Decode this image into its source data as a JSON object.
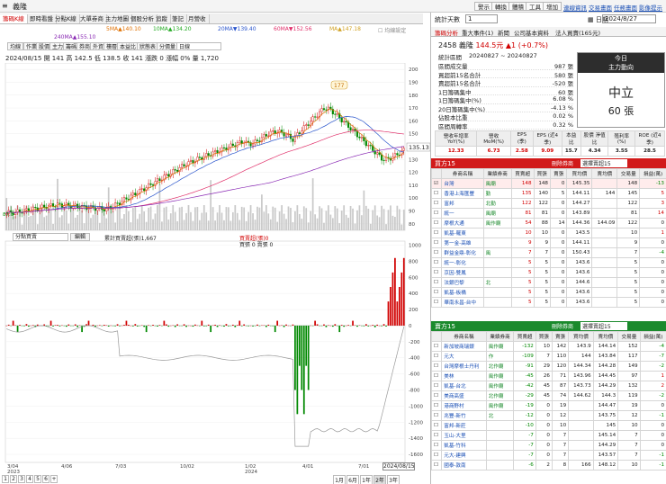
{
  "topbar": {
    "menu_icon": "≡",
    "title": "義隆",
    "buttons": [
      "警示",
      "轉換",
      "體積",
      "工具",
      "增加"
    ],
    "links": [
      "連線資訊",
      "交易畫面",
      "任務畫面",
      "影像提示"
    ]
  },
  "tabs": [
    "籌碼K線",
    "即時看盤",
    "分點K線",
    "大單券商",
    "主力地圖",
    "個股分析",
    "追蹤",
    "筆記",
    "月營收"
  ],
  "ma_legend": [
    {
      "label": "5MA▲140.10",
      "color": "#e07000"
    },
    {
      "label": "10MA▲134.20",
      "color": "#22aa22"
    },
    {
      "label": "20MA▼139.40",
      "color": "#2a55cc"
    },
    {
      "label": "60MA▼152.56",
      "color": "#e0306a"
    },
    {
      "label": "MA▲147.18",
      "color": "#d0a020"
    },
    {
      "label": "240MA▲155.10",
      "color": "#8a2ab4"
    },
    {
      "label": "☐ 均線設定",
      "color": "#888888"
    }
  ],
  "toolbar": [
    "均線",
    "作業",
    "股價",
    "主力",
    "籌碼",
    "券商",
    "外資",
    "樓層",
    "本益比",
    "狀態表",
    "分價量",
    "日線"
  ],
  "ohlc_text": "2024/08/15 開 141 高 142.5 低 138.5 收 141 漲跌 0 漲幅 0% 量 1,720",
  "price_axis": [
    "200",
    "190",
    "180",
    "170",
    "160",
    "150",
    "140",
    "130",
    "120",
    "110",
    "100",
    "90",
    "80"
  ],
  "price_tags": {
    "current": "135.13",
    "peak": "177",
    "low": "87.3"
  },
  "vol_axis": [
    "1000",
    "800",
    "600",
    "400",
    "200",
    "0",
    "-200",
    "-400",
    "-600",
    "-800",
    "-1000",
    "-1200",
    "-1400",
    "-1600"
  ],
  "indicator_bar": {
    "select": "分點買賣",
    "btn": "編輯",
    "legend1": "累計買賣超(張)1,667",
    "legend2": "買賣超(張)0",
    "legend3": "買張 0 賣張 0"
  },
  "x_axis": [
    "3/04\n2023",
    "4/06",
    "7/03",
    "10/02",
    "1/02\n2024",
    "4/01",
    "7/01",
    "2024/08/15"
  ],
  "bottom_tabs": [
    "1",
    "2",
    "3",
    "4",
    "5",
    "6",
    "+"
  ],
  "range_tabs": [
    "1月",
    "6月",
    "1年",
    "2年",
    "3年"
  ],
  "right": {
    "stat_label": "統計天數",
    "stat_value": "1",
    "date_label": "日期",
    "date_value": "2024/8/27",
    "sub_tabs": [
      "籌碼分析",
      "重大事件(1)",
      "新聞",
      "公司基本資料",
      "法人買賣(165元)"
    ],
    "stock_line": {
      "code": "2458 義隆",
      "price": "144.5元",
      "change": "▲1 (+0.7%)"
    },
    "period_label": "統計區間",
    "period_value": "20240827 ~ 20240827",
    "summary_rows": [
      {
        "label": "區間成交量",
        "value": "987 張"
      },
      {
        "label": "買超前15名合計",
        "value": "580 張"
      },
      {
        "label": "賣超前15名合計",
        "value": "-520 張"
      },
      {
        "label": "1日籌碼集中",
        "value": "60 張"
      },
      {
        "label": "1日籌碼集中(%)",
        "value": "6.08 %"
      },
      {
        "label": "20日籌碼集中(%)",
        "value": "-4.13 %"
      },
      {
        "label": "佔股本比重",
        "value": "0.02 %"
      },
      {
        "label": "區間周轉率",
        "value": "0.32 %"
      }
    ],
    "today_box": {
      "title": "今日",
      "sub": "主力動向",
      "state": "中立",
      "amount": "60 張"
    },
    "metrics_head": [
      "營收年增率 YoY(%)",
      "營收 MoM(%)",
      "EPS (季)",
      "EPS (近4季)",
      "本益比",
      "股價 淨值比",
      "殖利率 (%)",
      "ROE (近4季)"
    ],
    "metrics_vals": [
      "12.33",
      "6.73",
      "2.58",
      "9.09",
      "15.7",
      "4.34",
      "3.55",
      "28.5"
    ],
    "buy_title": "買方15",
    "buy_btn": "刪除券商",
    "buy_select": "選擇賣超15",
    "sell_title": "賣方15",
    "sell_btn": "刪除券商",
    "sell_select": "選擇賣超15",
    "table_head": [
      "",
      "券商名稱",
      "業績券商",
      "買賣超",
      "買張",
      "賣張",
      "買均價",
      "賣均價",
      "交易量",
      "損益(萬)"
    ],
    "buy_rows": [
      [
        "台灣",
        "風廟",
        "148",
        "148",
        "0",
        "145.35",
        "",
        "148",
        "-13"
      ],
      [
        "香港上海匯豐",
        "勤",
        "135",
        "140",
        "5",
        "144.11",
        "144",
        "145",
        "5"
      ],
      [
        "富邦",
        "北勤",
        "122",
        "122",
        "0",
        "144.27",
        "",
        "122",
        "3"
      ],
      [
        "統一",
        "風廟",
        "81",
        "81",
        "0",
        "143.89",
        "",
        "81",
        "14"
      ],
      [
        "摩根大通",
        "風作廟",
        "54",
        "88",
        "14",
        "144.36",
        "144.09",
        "122",
        "0"
      ],
      [
        "凱基-羅東",
        "",
        "10",
        "10",
        "0",
        "143.5",
        "",
        "10",
        "1"
      ],
      [
        "第一金-高雄",
        "",
        "9",
        "9",
        "0",
        "144.11",
        "",
        "9",
        "0"
      ],
      [
        "群益金鼎-彰化",
        "風",
        "7",
        "7",
        "0",
        "150.43",
        "",
        "7",
        "-4"
      ],
      [
        "統一-彰化",
        "",
        "5",
        "5",
        "0",
        "143.6",
        "",
        "5",
        "0"
      ],
      [
        "京因-雙鳳",
        "",
        "5",
        "5",
        "0",
        "143.6",
        "",
        "5",
        "0"
      ],
      [
        "法銀巴黎",
        "北",
        "5",
        "5",
        "0",
        "144.6",
        "",
        "5",
        "0"
      ],
      [
        "凱基-板橋",
        "",
        "5",
        "5",
        "0",
        "143.6",
        "",
        "5",
        "0"
      ],
      [
        "華南永昌-台中",
        "",
        "5",
        "5",
        "0",
        "143.6",
        "",
        "5",
        "0"
      ]
    ],
    "sell_rows": [
      [
        "新加坡商瑞銀",
        "風作廟",
        "-132",
        "10",
        "142",
        "143.9",
        "144.14",
        "152",
        "-4"
      ],
      [
        "元大",
        "作",
        "-109",
        "7",
        "110",
        "144",
        "143.84",
        "117",
        "-7"
      ],
      [
        "台灣摩根士丹利",
        "北作廟",
        "-91",
        "29",
        "120",
        "144.34",
        "144.28",
        "149",
        "-2"
      ],
      [
        "美林",
        "風作廟",
        "-45",
        "26",
        "71",
        "143.96",
        "144.45",
        "97",
        "1"
      ],
      [
        "凱基-台北",
        "風作廟",
        "-42",
        "45",
        "87",
        "143.73",
        "144.29",
        "132",
        "2"
      ],
      [
        "美商高盛",
        "北作廟",
        "-29",
        "45",
        "74",
        "144.62",
        "144.3",
        "119",
        "-2"
      ],
      [
        "港商野村",
        "風作廟",
        "-19",
        "0",
        "19",
        "",
        "144.47",
        "19",
        "0"
      ],
      [
        "兆豐-新竹",
        "北",
        "-12",
        "0",
        "12",
        "",
        "143.75",
        "12",
        "-1"
      ],
      [
        "富邦-新莊",
        "",
        "-10",
        "0",
        "10",
        "",
        "145",
        "10",
        "0"
      ],
      [
        "玉山-大里",
        "",
        "-7",
        "0",
        "7",
        "",
        "145.14",
        "7",
        "0"
      ],
      [
        "凱基-竹科",
        "",
        "-7",
        "0",
        "7",
        "",
        "144.29",
        "7",
        "0"
      ],
      [
        "元大-建興",
        "",
        "-7",
        "0",
        "7",
        "",
        "143.57",
        "7",
        "-1"
      ],
      [
        "國泰-敦南",
        "",
        "-6",
        "2",
        "8",
        "166",
        "148.12",
        "10",
        "-1"
      ]
    ]
  },
  "colors": {
    "up": "#d10000",
    "down": "#008800",
    "accent": "#2d2d2d"
  }
}
